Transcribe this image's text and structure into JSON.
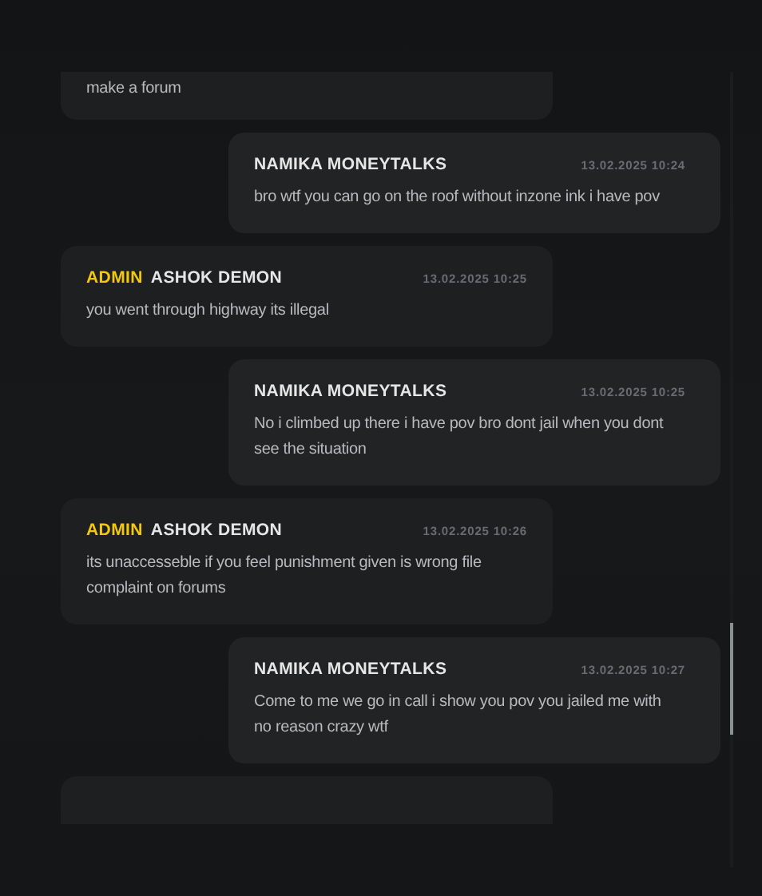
{
  "messages": [
    {
      "kind": "cut-top",
      "text": "make a forum"
    },
    {
      "kind": "message",
      "outgoing": true,
      "author": "NAMIKA MONEYTALKS",
      "time": "13.02.2025 10:24",
      "text": "bro wtf you can go on the roof without inzone ink i have pov"
    },
    {
      "kind": "message",
      "outgoing": false,
      "badge": "ADMIN",
      "author": "ASHOK DEMON",
      "time": "13.02.2025 10:25",
      "text": "you went through highway its illegal"
    },
    {
      "kind": "message",
      "outgoing": true,
      "author": "NAMIKA MONEYTALKS",
      "time": "13.02.2025 10:25",
      "text": "No i climbed up there i have pov bro dont jail when you dont see the situation"
    },
    {
      "kind": "message",
      "outgoing": false,
      "badge": "ADMIN",
      "author": "ASHOK DEMON",
      "time": "13.02.2025 10:26",
      "text": "its unaccesseble if you feel punishment given is wrong file complaint on forums"
    },
    {
      "kind": "message",
      "outgoing": true,
      "author": "NAMIKA MONEYTALKS",
      "time": "13.02.2025 10:27",
      "text": "Come to me we go in call i show you pov you jailed me with no reason crazy wtf"
    },
    {
      "kind": "cut-bottom"
    }
  ]
}
